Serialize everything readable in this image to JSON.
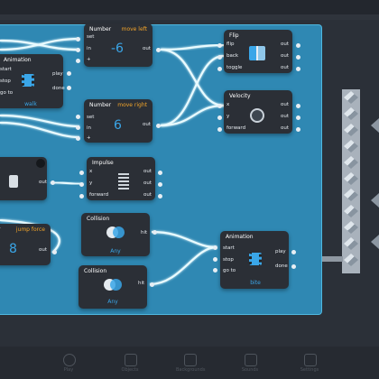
{
  "nodes": {
    "number_left": {
      "title": "Number",
      "tag": "move left",
      "value": "-6",
      "inputs": [
        "set",
        "in",
        "+"
      ],
      "outputs": [
        "out"
      ]
    },
    "number_right": {
      "title": "Number",
      "tag": "move right",
      "value": "6",
      "inputs": [
        "set",
        "in",
        "+"
      ],
      "outputs": [
        "out"
      ]
    },
    "flip": {
      "title": "Flip",
      "inputs": [
        "flip",
        "back",
        "toggle"
      ],
      "outputs": [
        "out",
        "out",
        "out"
      ]
    },
    "velocity": {
      "title": "Velocity",
      "inputs": [
        "x",
        "y",
        "forward"
      ],
      "outputs": [
        "out",
        "out",
        "out"
      ]
    },
    "animation_walk": {
      "title": "Animation",
      "inputs": [
        "start",
        "stop",
        "go to"
      ],
      "outputs": [
        "play",
        "done"
      ],
      "caption": "walk"
    },
    "impulse": {
      "title": "Impulse",
      "inputs": [
        "x",
        "y",
        "forward"
      ],
      "outputs": [
        "out",
        "out",
        "out"
      ]
    },
    "collision1": {
      "title": "Collision",
      "outputs": [
        "hit"
      ],
      "caption": "Any"
    },
    "collision2": {
      "title": "Collision",
      "outputs": [
        "hit"
      ],
      "caption": "Any"
    },
    "number_jump": {
      "tag": "jump force",
      "value": "8",
      "outputs": [
        "out"
      ]
    },
    "animation_bite": {
      "title": "Animation",
      "inputs": [
        "start",
        "stop",
        "go to"
      ],
      "outputs": [
        "play",
        "done"
      ],
      "caption": "bite"
    },
    "switch": {
      "outputs": [
        "out"
      ]
    }
  },
  "bottom_bar": {
    "items": [
      "Play",
      "Objects",
      "Backgrounds",
      "Sounds",
      "Settings"
    ]
  }
}
